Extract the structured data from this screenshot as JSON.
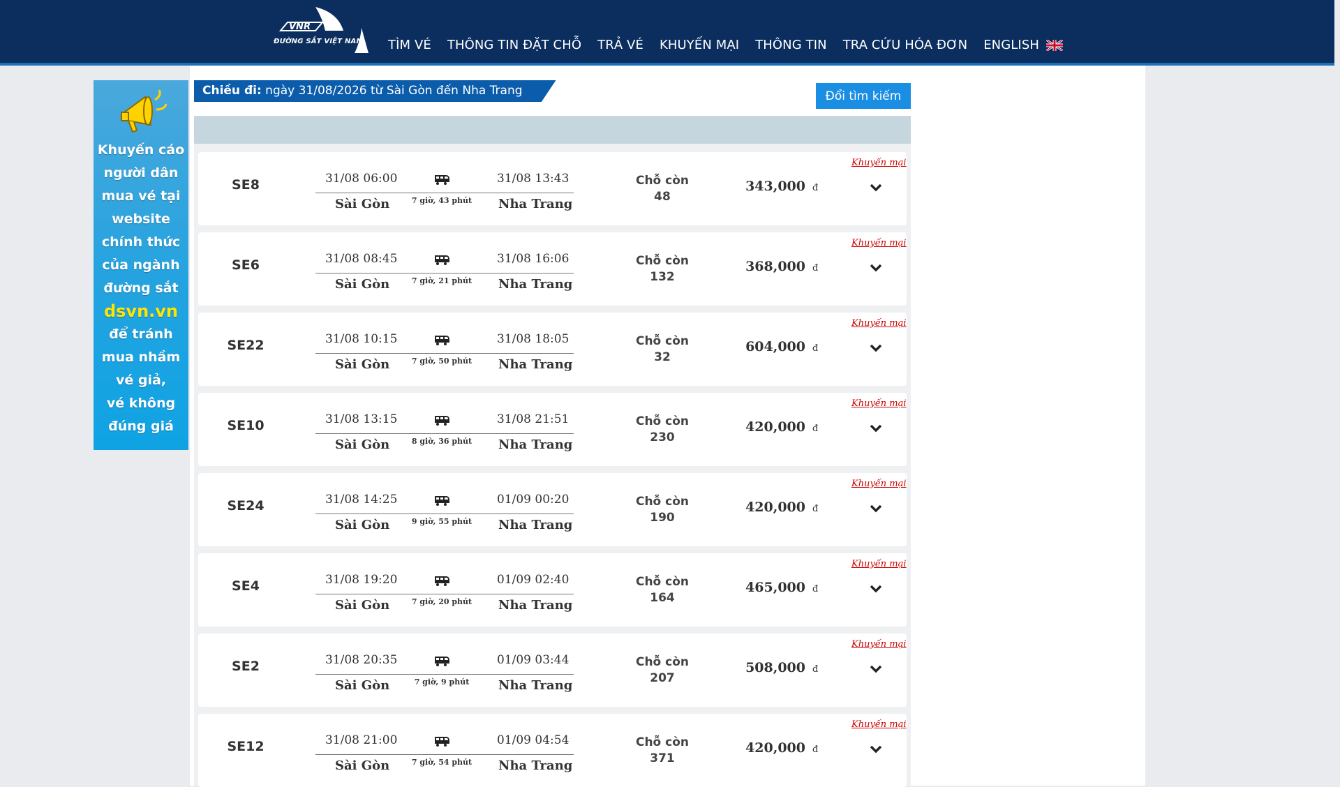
{
  "header": {
    "logo_text": "ĐƯỜNG SẮT VIỆT NAM",
    "logo_abbr": "VNR",
    "nav": [
      "TÌM VÉ",
      "THÔNG TIN ĐẶT CHỖ",
      "TRẢ VÉ",
      "KHUYẾN MẠI",
      "THÔNG TIN",
      "TRA CỨU HÓA ĐƠN",
      "ENGLISH"
    ],
    "flag_icon": "uk-flag-icon"
  },
  "banner": {
    "lines": [
      "Khuyến cáo",
      "người dân",
      "mua vé tại",
      "website",
      "chính thức",
      "của ngành",
      "đường sắt"
    ],
    "highlight": "dsvn.vn",
    "lines_after": [
      "để tránh",
      "mua nhầm",
      "vé giả,",
      "vé không",
      "đúng giá"
    ],
    "icon": "megaphone-icon"
  },
  "route": {
    "label": "Chiều đi:",
    "text": " ngày 31/08/2026 từ Sài Gòn đến Nha Trang",
    "change_button": "Đổi tìm kiếm"
  },
  "common": {
    "seat_label": "Chỗ còn",
    "currency": "đ",
    "promo": "Khuyến mại"
  },
  "trains": [
    {
      "code": "SE8",
      "dep_time": "31/08 06:00",
      "arr_time": "31/08 13:43",
      "dep_station": "Sài Gòn",
      "arr_station": "Nha Trang",
      "duration": "7 giờ, 43 phút",
      "seats": "48",
      "price": "343,000"
    },
    {
      "code": "SE6",
      "dep_time": "31/08 08:45",
      "arr_time": "31/08 16:06",
      "dep_station": "Sài Gòn",
      "arr_station": "Nha Trang",
      "duration": "7 giờ, 21 phút",
      "seats": "132",
      "price": "368,000"
    },
    {
      "code": "SE22",
      "dep_time": "31/08 10:15",
      "arr_time": "31/08 18:05",
      "dep_station": "Sài Gòn",
      "arr_station": "Nha Trang",
      "duration": "7 giờ, 50 phút",
      "seats": "32",
      "price": "604,000"
    },
    {
      "code": "SE10",
      "dep_time": "31/08 13:15",
      "arr_time": "31/08 21:51",
      "dep_station": "Sài Gòn",
      "arr_station": "Nha Trang",
      "duration": "8 giờ, 36 phút",
      "seats": "230",
      "price": "420,000"
    },
    {
      "code": "SE24",
      "dep_time": "31/08 14:25",
      "arr_time": "01/09 00:20",
      "dep_station": "Sài Gòn",
      "arr_station": "Nha Trang",
      "duration": "9 giờ, 55 phút",
      "seats": "190",
      "price": "420,000"
    },
    {
      "code": "SE4",
      "dep_time": "31/08 19:20",
      "arr_time": "01/09 02:40",
      "dep_station": "Sài Gòn",
      "arr_station": "Nha Trang",
      "duration": "7 giờ, 20 phút",
      "seats": "164",
      "price": "465,000"
    },
    {
      "code": "SE2",
      "dep_time": "31/08 20:35",
      "arr_time": "01/09 03:44",
      "dep_station": "Sài Gòn",
      "arr_station": "Nha Trang",
      "duration": "7 giờ, 9 phút",
      "seats": "207",
      "price": "508,000"
    },
    {
      "code": "SE12",
      "dep_time": "31/08 21:00",
      "arr_time": "01/09 04:54",
      "dep_station": "Sài Gòn",
      "arr_station": "Nha Trang",
      "duration": "7 giờ, 54 phút",
      "seats": "371",
      "price": "420,000"
    }
  ]
}
